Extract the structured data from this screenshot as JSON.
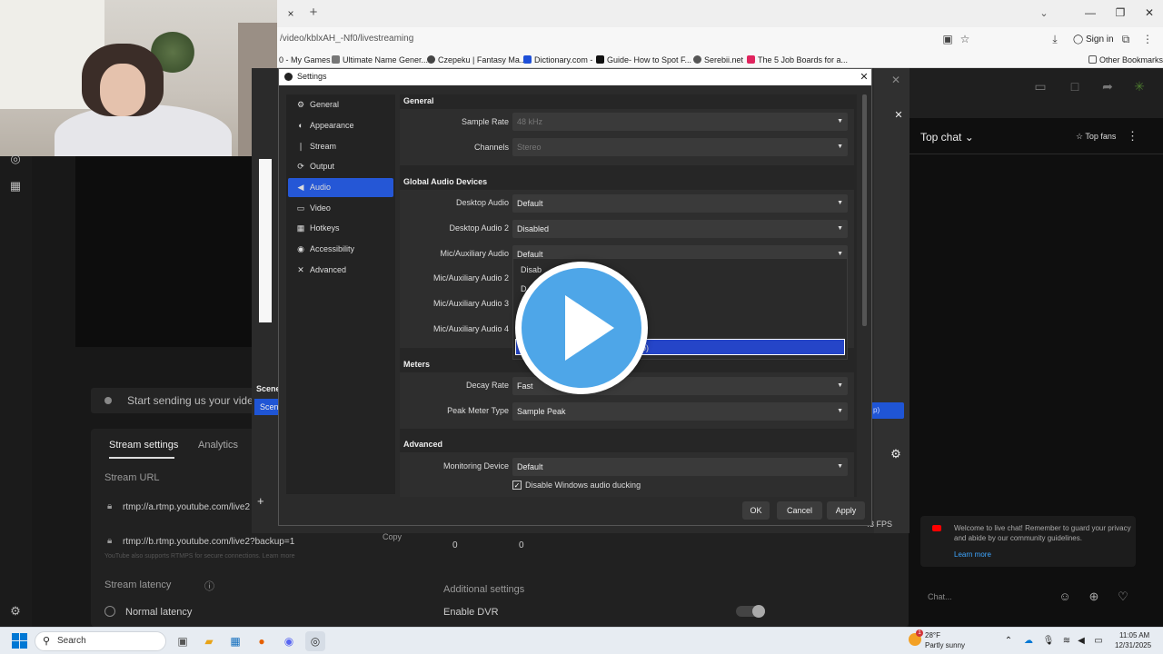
{
  "browser": {
    "url": "/video/kblxAH_-Nf0/livestreaming",
    "tab_close": "×",
    "new_tab": "+",
    "sign_in": "Sign in",
    "other_bookmarks": "Other Bookmarks",
    "bookmarks": [
      "0 - My Games",
      "Ultimate Name Gener...",
      "Czepeku | Fantasy Ma...",
      "Dictionary.com -",
      "Guide- How to Spot F...",
      "Serebii.net",
      "The 5 Job Boards for a..."
    ]
  },
  "youtube": {
    "start_sending": "Start sending us your video fi",
    "tabs": [
      "Stream settings",
      "Analytics"
    ],
    "stream_url_label": "Stream URL",
    "stream_key_1": "rtmp://a.rtmp.youtube.com/live2",
    "stream_key_2": "rtmp://b.rtmp.youtube.com/live2?backup=1",
    "copy": "Copy",
    "backup_note": "YouTube also supports RTMPS for secure connections. Learn more",
    "stream_latency": "Stream latency",
    "normal_latency": "Normal latency",
    "additional_settings": "Additional settings",
    "enable_dvr": "Enable DVR",
    "stat_zero_1": "0",
    "stat_zero_2": "0"
  },
  "obs_main": {
    "scenes_label": "Scene",
    "scene_item": "Scene",
    "fps": "43 FPS",
    "highlight_text": "p)"
  },
  "chat": {
    "title": "Top chat",
    "top_fans": "Top fans",
    "welcome": "Welcome to live chat! Remember to guard your privacy and abide by our community guidelines.",
    "learn_more": "Learn more",
    "input_placeholder": "Chat..."
  },
  "settings": {
    "title": "Settings",
    "nav": [
      "General",
      "Appearance",
      "Stream",
      "Output",
      "Audio",
      "Video",
      "Hotkeys",
      "Accessibility",
      "Advanced"
    ],
    "active_nav": "Audio",
    "sections": {
      "general": "General",
      "global_audio": "Global Audio Devices",
      "meters": "Meters",
      "advanced": "Advanced"
    },
    "fields": {
      "sample_rate_label": "Sample Rate",
      "sample_rate": "48 kHz",
      "channels_label": "Channels",
      "channels": "Stereo",
      "desktop_audio_label": "Desktop Audio",
      "desktop_audio": "Default",
      "desktop_audio_2_label": "Desktop Audio 2",
      "desktop_audio_2": "Disabled",
      "mic_aux_label": "Mic/Auxiliary Audio",
      "mic_aux": "Default",
      "mic_aux_2_label": "Mic/Auxiliary Audio 2",
      "mic_aux_3_label": "Mic/Auxiliary Audio 3",
      "mic_aux_4_label": "Mic/Auxiliary Audio 4",
      "decay_rate_label": "Decay Rate",
      "decay_rate": "Fast",
      "peak_meter_label": "Peak Meter Type",
      "peak_meter": "Sample Peak",
      "monitoring_label": "Monitoring Device",
      "monitoring": "Default",
      "ducking": "Disable Windows audio ducking"
    },
    "dropdown_options": [
      "Disab",
      "D",
      "",
      "",
      "o)"
    ],
    "dropdown_selected_index": 4,
    "buttons": {
      "ok": "OK",
      "cancel": "Cancel",
      "apply": "Apply"
    }
  },
  "taskbar": {
    "search": "Search",
    "weather_temp": "28°F",
    "weather_desc": "Partly sunny",
    "weather_badge": "1",
    "time": "11:05 AM",
    "date": "12/31/2025"
  },
  "colors": {
    "accent": "#2557d6",
    "play": "#4ea6e8"
  }
}
